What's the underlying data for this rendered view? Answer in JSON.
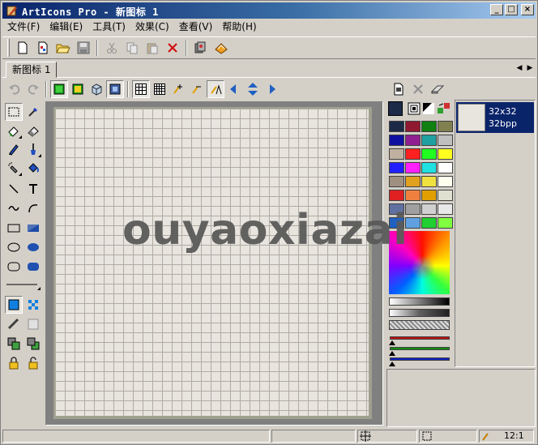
{
  "window": {
    "title": "ArtIcons Pro - 新图标 1",
    "minimize_glyph": "_",
    "maximize_glyph": "□",
    "close_glyph": "×"
  },
  "menu": [
    {
      "label": "文件(F)"
    },
    {
      "label": "编辑(E)"
    },
    {
      "label": "工具(T)"
    },
    {
      "label": "效果(C)"
    },
    {
      "label": "查看(V)"
    },
    {
      "label": "帮助(H)"
    }
  ],
  "toolbar": {
    "icons": [
      "new-file-icon",
      "new-template-icon",
      "open-folder-icon",
      "save-icon",
      "cut-icon",
      "copy-icon",
      "paste-icon",
      "delete-icon",
      "icon-library-icon",
      "resource-icon"
    ]
  },
  "tabs": {
    "active": "新图标 1",
    "scroll_left": "◀",
    "scroll_right": "▶"
  },
  "icon_sizes": [
    {
      "size": "32x32",
      "depth": "32bpp"
    }
  ],
  "watermark": "ouyaoxiazai",
  "statusbar": {
    "zoom": "12:1"
  },
  "colors": {
    "title_start": "#0a246a",
    "selection": "#0a246a",
    "face": "#d4d0c8",
    "canvas": "#e8e4de"
  }
}
